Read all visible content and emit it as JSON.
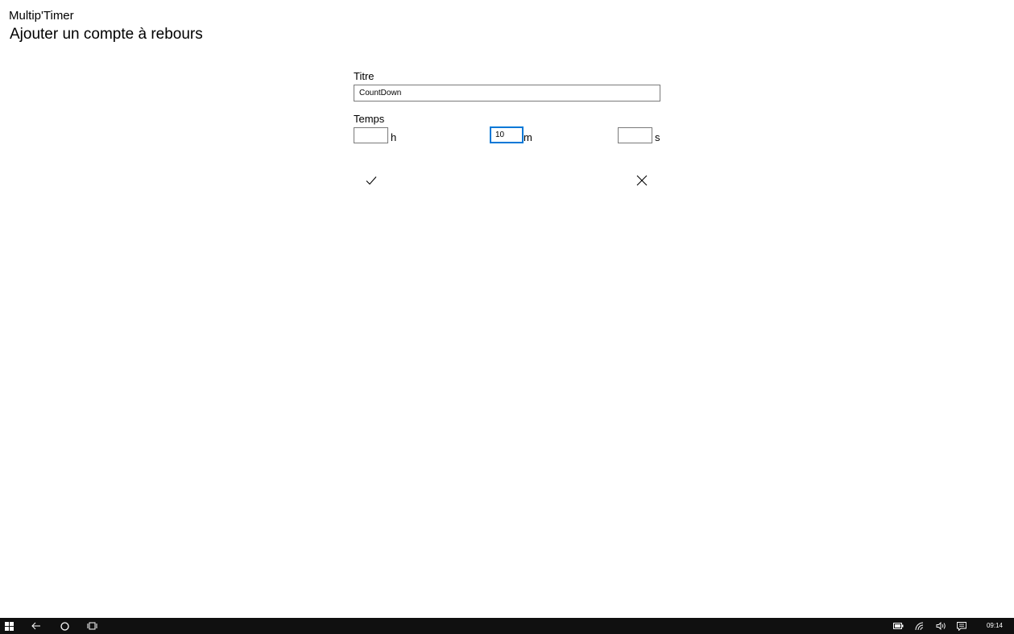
{
  "app": {
    "name": "Multip'Timer",
    "page_title": "Ajouter un compte à rebours"
  },
  "form": {
    "title_label": "Titre",
    "title_value": "CountDown",
    "time_label": "Temps",
    "hours_value": "",
    "hours_unit": "h",
    "minutes_value": "10",
    "minutes_unit": "m",
    "seconds_value": "",
    "seconds_unit": "s",
    "focused_field": "minutes"
  },
  "actions": {
    "confirm_icon": "checkmark-icon",
    "cancel_icon": "close-icon"
  },
  "taskbar": {
    "icons": [
      "windows-start-icon",
      "back-arrow-icon",
      "cortana-circle-icon",
      "task-view-icon",
      "battery-icon",
      "wifi-icon",
      "volume-icon",
      "action-center-icon"
    ],
    "clock": "09:14"
  },
  "colors": {
    "focus_accent": "#0078d7",
    "taskbar_bg": "#101010",
    "input_border": "#7a7a7a"
  }
}
